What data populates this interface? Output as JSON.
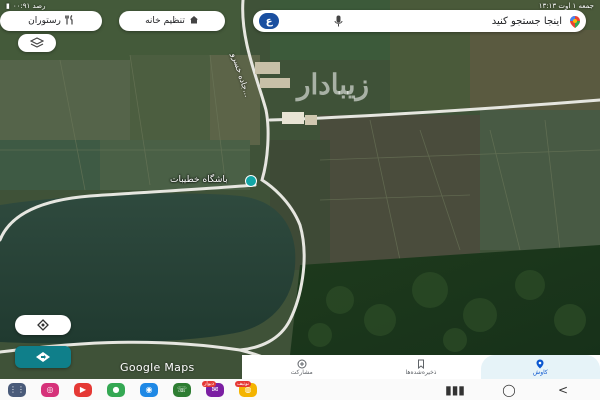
{
  "status_bar": {
    "time": "جمعه ۱ اوت ۱۳:۱۳",
    "battery": "٪۹۱",
    "network_label": "۰۰:۹۱ رصد"
  },
  "search": {
    "placeholder": "اینجا جستجو کنید",
    "avatar_letter": "ع"
  },
  "chips": {
    "home_label": "تنظیم خانه",
    "restaurants_label": "رستوران"
  },
  "map": {
    "poi_label": "باشگاه خطیبات",
    "road_label": "جاده خسرو...",
    "watermark": "زیبادار",
    "google_logo": "Google Maps"
  },
  "bottom_nav": {
    "tabs": [
      {
        "label": "کاوش",
        "icon": "pin-icon",
        "active": true
      },
      {
        "label": "ذخیره‌شده‌ها",
        "icon": "bookmark-icon",
        "active": false
      },
      {
        "label": "مشارکت",
        "icon": "plus-circle-icon",
        "active": false
      }
    ]
  },
  "sysbar": {
    "apps": [
      {
        "icon": "apps-grid-icon",
        "color": "#4a5b7a"
      },
      {
        "icon": "instagram-icon",
        "color": "#d6327a"
      },
      {
        "icon": "youtube-icon",
        "color": "#e53935"
      },
      {
        "icon": "maps-icon",
        "color": "#34a853"
      },
      {
        "icon": "camera-icon",
        "color": "#1e88e5"
      },
      {
        "icon": "phone-icon",
        "color": "#2e7d32"
      },
      {
        "icon": "messenger-icon",
        "color": "#7b1fa2"
      },
      {
        "icon": "chrome-icon",
        "color": "#f4b400"
      }
    ],
    "badges": [
      {
        "label": "نوتیف"
      },
      {
        "label": "دیوار"
      }
    ]
  },
  "colors": {
    "accent": "#0f7f8a",
    "search_avatar": "#1a4fa0",
    "active_tab": "#0b57d0"
  }
}
